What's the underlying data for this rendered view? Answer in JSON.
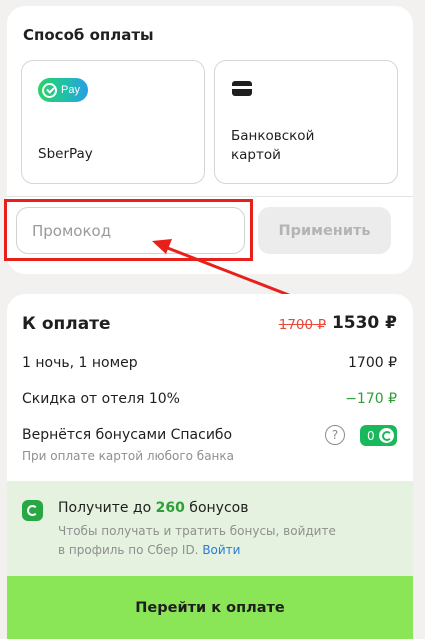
{
  "payment": {
    "title": "Способ оплаты",
    "methods": [
      {
        "label": "SberPay",
        "logo_text": "Pay"
      },
      {
        "label_line1": "Банковской",
        "label_line2": "картой"
      }
    ]
  },
  "promo": {
    "placeholder": "Промокод",
    "apply_label": "Применить"
  },
  "summary": {
    "title": "К оплате",
    "old_price": "1700 ₽",
    "new_price": "1530 ₽",
    "rows": [
      {
        "label": "1 ночь, 1 номер",
        "value": "1700 ₽"
      },
      {
        "label": "Скидка от отеля 10%",
        "value": "−170 ₽"
      }
    ],
    "bonus_title": "Вернётся бонусами Спасибо",
    "bonus_sub": "При оплате картой любого банка",
    "help_glyph": "?",
    "bonus_badge_value": "0"
  },
  "bonus_promo": {
    "title_prefix": "Получите до ",
    "title_number": "260",
    "title_suffix": " бонусов",
    "sub_line1": "Чтобы получать и тратить бонусы, войдите",
    "sub_line2_prefix": "в профиль по Сбер ID. ",
    "link": "Войти"
  },
  "cta": {
    "label": "Перейти к оплате"
  },
  "colors": {
    "accent_green": "#8ae557",
    "annotation_red": "#e8201c",
    "discount_green": "#2f9e36",
    "old_price_red": "#e84b3c"
  }
}
